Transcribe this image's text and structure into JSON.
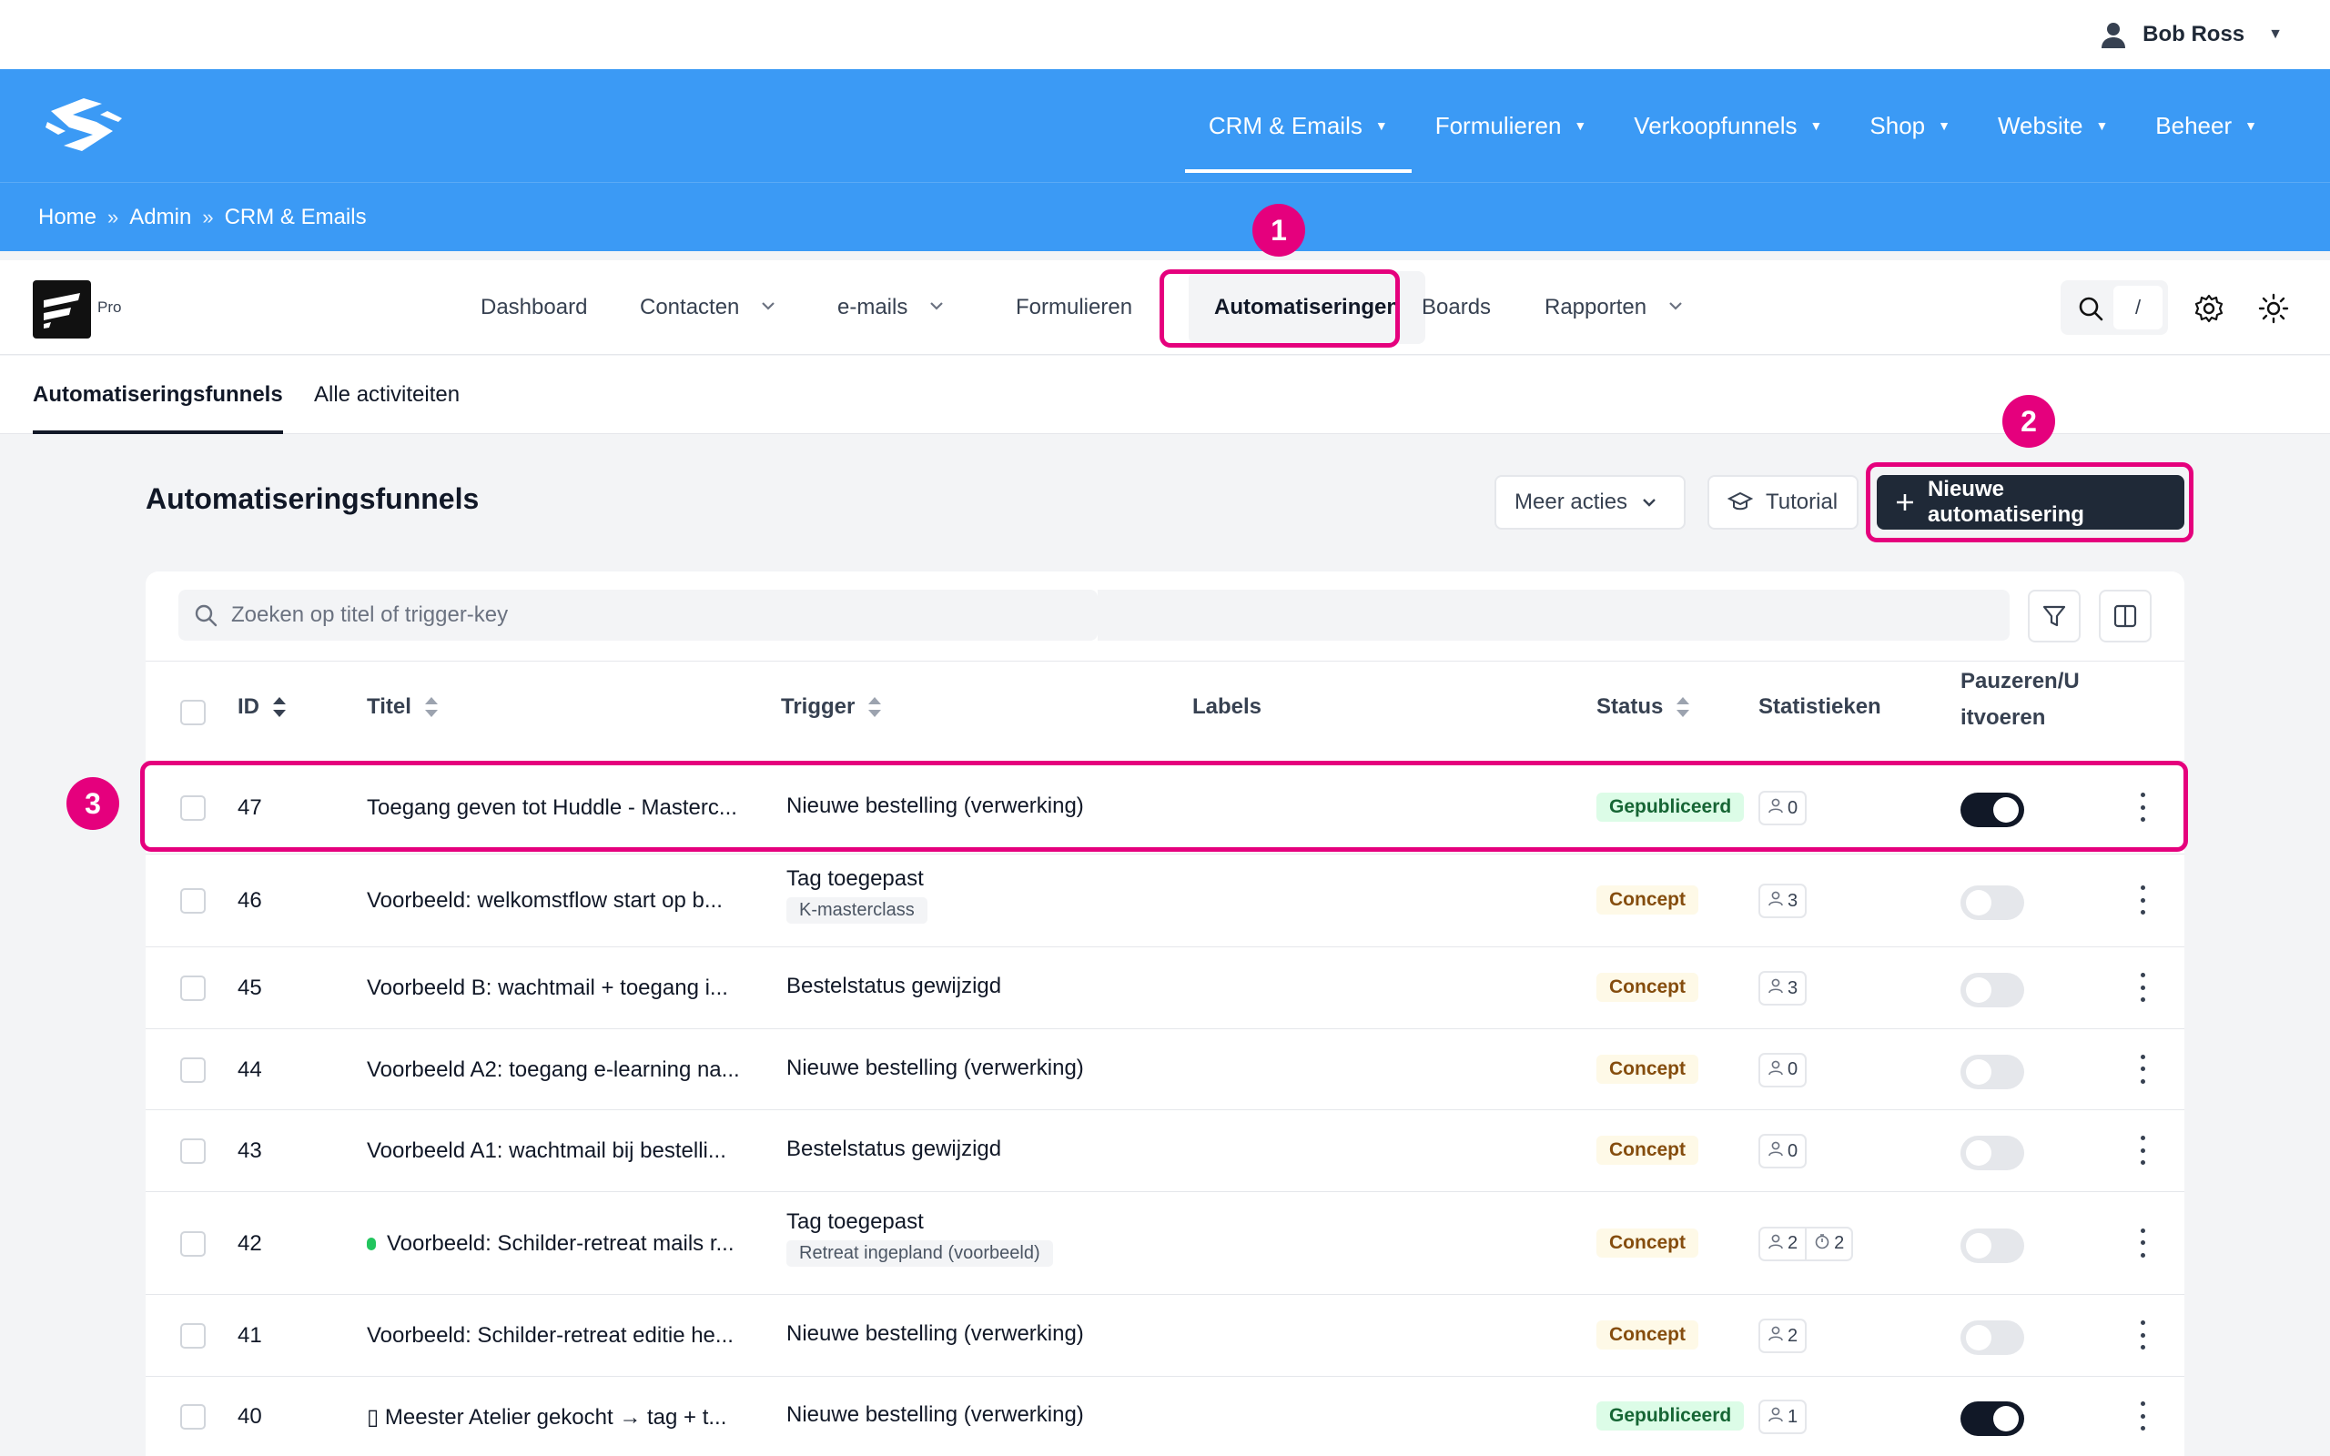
{
  "user": {
    "name": "Bob Ross"
  },
  "main_nav": [
    {
      "label": "CRM & Emails",
      "active": true
    },
    {
      "label": "Formulieren"
    },
    {
      "label": "Verkoopfunnels"
    },
    {
      "label": "Shop"
    },
    {
      "label": "Website"
    },
    {
      "label": "Beheer"
    }
  ],
  "breadcrumb": {
    "items": [
      "Home",
      "Admin",
      "CRM & Emails"
    ],
    "separator": "»"
  },
  "app": {
    "badge": "Pro",
    "search_shortcut": "/"
  },
  "app_nav": [
    {
      "label": "Dashboard"
    },
    {
      "label": "Contacten",
      "dropdown": true
    },
    {
      "label": "e-mails",
      "dropdown": true
    },
    {
      "label": "Formulieren"
    },
    {
      "label": "Automatiseringen",
      "active": true
    },
    {
      "label": "Boards"
    },
    {
      "label": "Rapporten",
      "dropdown": true
    }
  ],
  "sub_tabs": [
    {
      "label": "Automatiseringsfunnels",
      "active": true
    },
    {
      "label": "Alle activiteiten"
    }
  ],
  "page": {
    "title": "Automatiseringsfunnels",
    "more_actions": "Meer acties",
    "tutorial": "Tutorial",
    "new_button": "Nieuwe automatisering"
  },
  "annotations": [
    "1",
    "2",
    "3"
  ],
  "table": {
    "search_placeholder": "Zoeken op titel of trigger-key",
    "columns": {
      "id": "ID",
      "title": "Titel",
      "trigger": "Trigger",
      "labels": "Labels",
      "status": "Status",
      "stats": "Statistieken",
      "pause_line1": "Pauzeren/U",
      "pause_line2": "itvoeren"
    },
    "rows": [
      {
        "id": "47",
        "title": "Toegang geven tot Huddle - Masterc...",
        "trigger": "Nieuwe bestelling (verwerking)",
        "tag": "",
        "status": "Gepubliceerd",
        "stat1": "0",
        "stat2": "",
        "on": true
      },
      {
        "id": "46",
        "title": "Voorbeeld: welkomstflow start op b...",
        "trigger": "Tag toegepast",
        "tag": "K-masterclass",
        "status": "Concept",
        "stat1": "3",
        "stat2": "",
        "on": false
      },
      {
        "id": "45",
        "title": "Voorbeeld B: wachtmail + toegang i...",
        "trigger": "Bestelstatus gewijzigd",
        "tag": "",
        "status": "Concept",
        "stat1": "3",
        "stat2": "",
        "on": false
      },
      {
        "id": "44",
        "title": "Voorbeeld A2: toegang e-learning na...",
        "trigger": "Nieuwe bestelling (verwerking)",
        "tag": "",
        "status": "Concept",
        "stat1": "0",
        "stat2": "",
        "on": false
      },
      {
        "id": "43",
        "title": "Voorbeeld A1: wachtmail bij bestelli...",
        "trigger": "Bestelstatus gewijzigd",
        "tag": "",
        "status": "Concept",
        "stat1": "0",
        "stat2": "",
        "on": false
      },
      {
        "id": "42",
        "title": "Voorbeeld: Schilder-retreat mails r...",
        "trigger": "Tag toegepast",
        "tag": "Retreat ingepland (voorbeeld)",
        "status": "Concept",
        "stat1": "2",
        "stat2": "2",
        "on": false,
        "dot": true
      },
      {
        "id": "41",
        "title": "Voorbeeld: Schilder-retreat editie he...",
        "trigger": "Nieuwe bestelling (verwerking)",
        "tag": "",
        "status": "Concept",
        "stat1": "2",
        "stat2": "",
        "on": false
      },
      {
        "id": "40",
        "title": "▯ Meester Atelier gekocht → tag + t...",
        "trigger": "Nieuwe bestelling (verwerking)",
        "tag": "",
        "status": "Gepubliceerd",
        "stat1": "1",
        "stat2": "",
        "on": true
      }
    ]
  }
}
